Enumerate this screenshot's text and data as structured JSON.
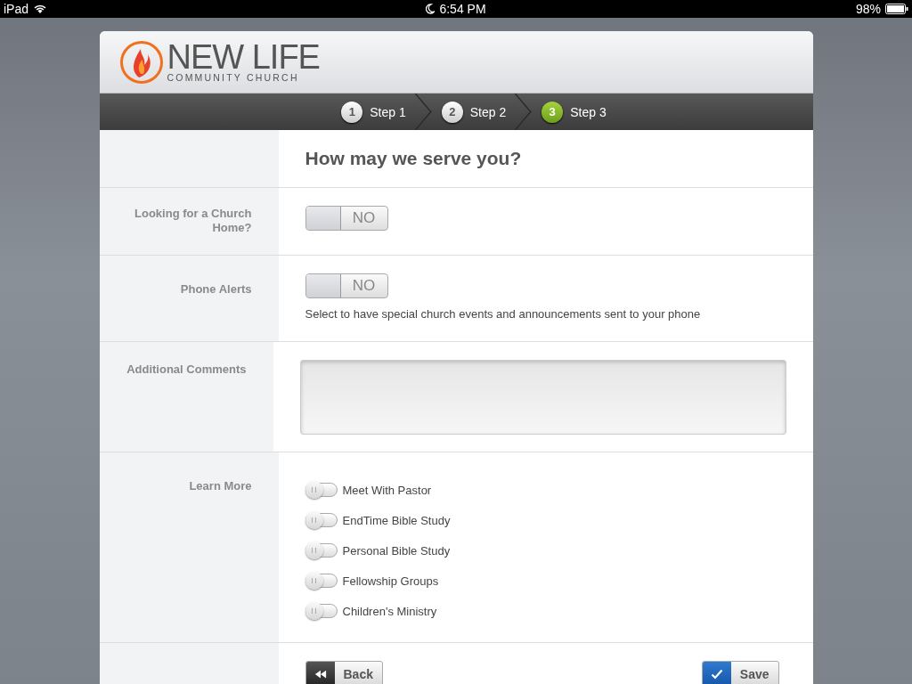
{
  "status_bar": {
    "device": "iPad",
    "time": "6:54 PM",
    "battery": "98%"
  },
  "logo": {
    "name": "NEW LIFE",
    "tagline": "COMMUNITY CHURCH"
  },
  "steps": [
    {
      "number": "1",
      "label": "Step 1",
      "selected": false
    },
    {
      "number": "2",
      "label": "Step 2",
      "selected": false
    },
    {
      "number": "3",
      "label": "Step 3",
      "selected": true
    }
  ],
  "form": {
    "title": "How may we serve you?",
    "fields": [
      {
        "kind": "toggle",
        "label": "Looking for a Church Home?",
        "on": false,
        "value": "NO"
      },
      {
        "kind": "toggle",
        "label": "Phone Alerts",
        "on": false,
        "value": "NO",
        "hint": "Select to have special church events and announcements sent to your phone"
      },
      {
        "kind": "textarea",
        "label": "Additional Comments"
      },
      {
        "kind": "checklist",
        "label": "Learn More",
        "options": [
          {
            "label": "Meet With Pastor",
            "on": false
          },
          {
            "label": "EndTime Bible Study",
            "on": false
          },
          {
            "label": "Personal Bible Study",
            "on": false
          },
          {
            "label": "Fellowship Groups",
            "on": false
          },
          {
            "label": "Children's Ministry",
            "on": false
          }
        ]
      }
    ]
  },
  "buttons": [
    {
      "kind": "back",
      "label": "Back"
    },
    {
      "kind": "save",
      "label": "Save"
    }
  ]
}
